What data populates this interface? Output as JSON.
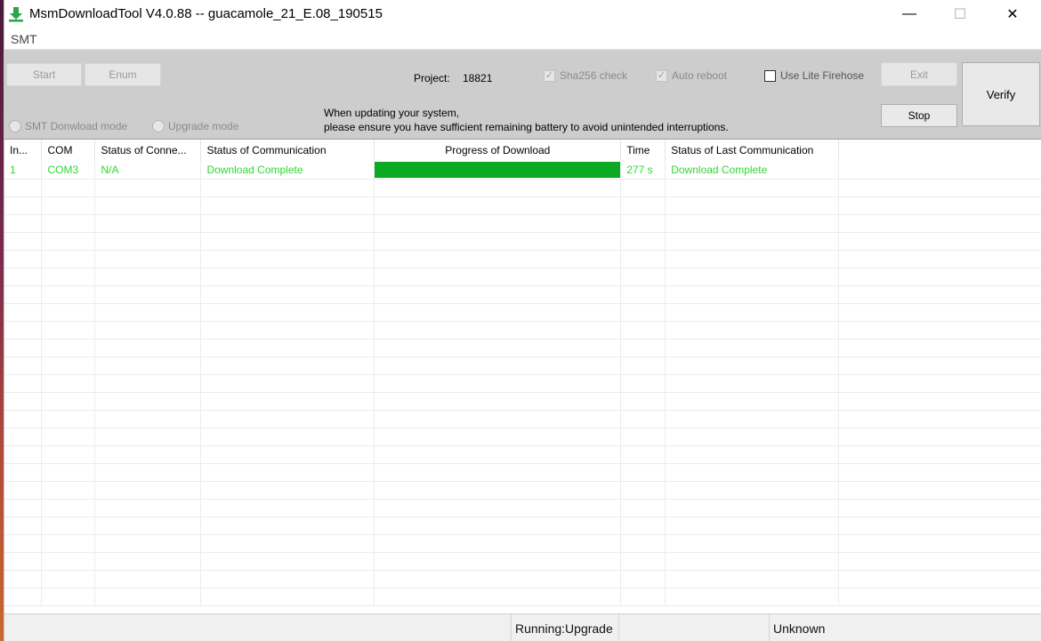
{
  "window": {
    "title": "MsmDownloadTool V4.0.88 -- guacamole_21_E.08_190515",
    "controls": {
      "minimize": "—",
      "maximize": "☐",
      "close": "✕"
    }
  },
  "menu": {
    "items": [
      "SMT"
    ]
  },
  "toolbar": {
    "start_label": "Start",
    "enum_label": "Enum",
    "project_label": "Project:",
    "project_value": "18821",
    "sha256": {
      "label": "Sha256 check",
      "checked": true,
      "enabled": false
    },
    "auto_reboot": {
      "label": "Auto reboot",
      "checked": true,
      "enabled": false
    },
    "lite_firehose": {
      "label": "Use Lite Firehose",
      "checked": false,
      "enabled": true
    },
    "exit_label": "Exit",
    "stop_label": "Stop",
    "verify_label": "Verify",
    "smt_mode_label": "SMT Donwload mode",
    "upgrade_mode_label": "Upgrade mode",
    "notice_line1": "When updating your system,",
    "notice_line2": "please ensure you have sufficient remaining battery to avoid unintended interruptions."
  },
  "grid": {
    "columns": [
      "In...",
      "COM",
      "Status of Conne...",
      "Status of Communication",
      "Progress of Download",
      "Time",
      "Status of Last Communication",
      ""
    ],
    "rows": [
      {
        "index": "1",
        "com": "COM3",
        "connection": "N/A",
        "communication": "Download Complete",
        "progress": 1.0,
        "time": "277 s",
        "last_communication": "Download Complete"
      }
    ],
    "empty_rows": 24
  },
  "statusbar": {
    "running": "Running:Upgrade",
    "middle": "",
    "state": "Unknown"
  },
  "colors": {
    "progress_fill": "#0caa24",
    "row_text": "#2fd82f",
    "app_icon": "#2aa74a"
  },
  "icons": {
    "app": "download-arrow-icon"
  }
}
